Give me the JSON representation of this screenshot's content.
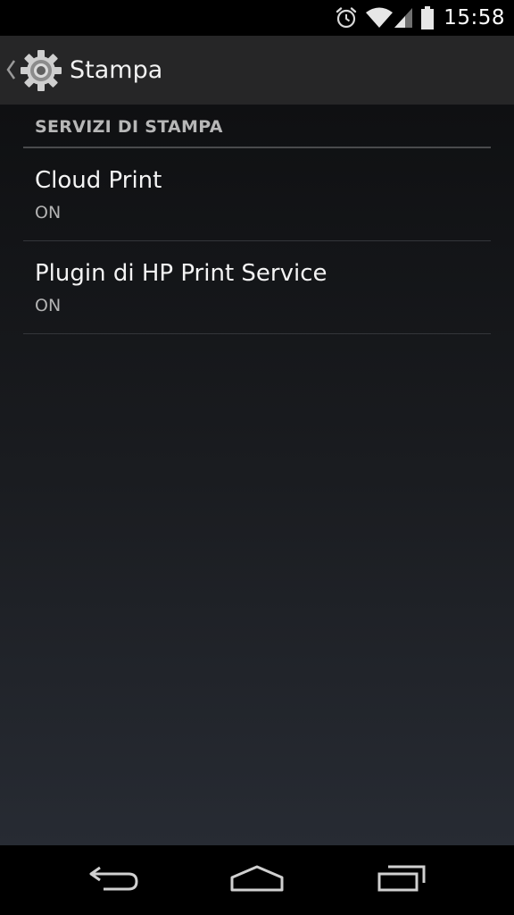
{
  "status_bar": {
    "time": "15:58",
    "icons": [
      "alarm-icon",
      "wifi-icon",
      "cell-signal-icon",
      "battery-icon"
    ]
  },
  "action_bar": {
    "title": "Stampa",
    "icon": "settings-gear-icon"
  },
  "section": {
    "header": "SERVIZI DI STAMPA"
  },
  "items": [
    {
      "title": "Cloud Print",
      "summary": "ON"
    },
    {
      "title": "Plugin di HP Print Service",
      "summary": "ON"
    }
  ],
  "nav_bar": {
    "buttons": [
      "back-icon",
      "home-icon",
      "recents-icon"
    ]
  },
  "colors": {
    "action_bar_bg": "#262627",
    "content_top": "#0f1012",
    "content_bottom": "#272b33",
    "section_text": "#b7b7b7"
  }
}
